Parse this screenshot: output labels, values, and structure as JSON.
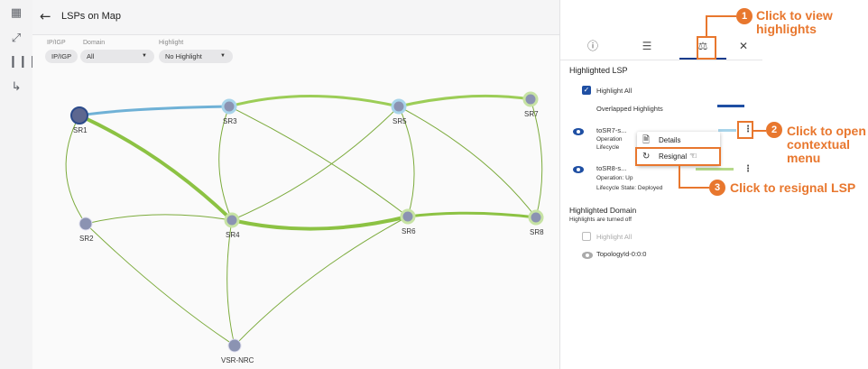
{
  "header": {
    "back_icon": "arrow-left-icon",
    "title": "LSPs on Map"
  },
  "sidebar": {
    "items": [
      "topology-icon",
      "link-icon",
      "barcode-icon",
      "path-icon"
    ]
  },
  "filters": {
    "ipigp": {
      "label": "IP/IGP",
      "value": "IP/IGP"
    },
    "domain": {
      "label": "Domain",
      "value": "All"
    },
    "highlight": {
      "label": "Highlight",
      "value": "No Highlight"
    }
  },
  "nodes": {
    "SR1": "SR1",
    "SR2": "SR2",
    "SR3": "SR3",
    "SR4": "SR4",
    "SR5": "SR5",
    "SR6": "SR6",
    "SR7": "SR7",
    "SR8": "SR8",
    "VSR": "VSR-NRC"
  },
  "panel": {
    "tabs": [
      "info-icon",
      "list-icon",
      "sliders-icon"
    ],
    "close_icon": "close-icon",
    "highlighted_lsp_title": "Highlighted LSP",
    "highlight_all": "Highlight All",
    "overlapped": "Overlapped Highlights",
    "lsp1": {
      "name": "toSR7-s...",
      "op": "Operation",
      "lc": "Lifecycle"
    },
    "lsp2": {
      "name": "toSR8-s...",
      "op": "Operation: Up",
      "lc": "Lifecycle State: Deployed"
    },
    "domain_title": "Highlighted Domain",
    "domain_sub": "Highlights are turned off",
    "domain_highlight_all": "Highlight All",
    "topology": "TopologyId-0:0:0"
  },
  "menu": {
    "details": "Details",
    "resignal": "Resignal"
  },
  "callouts": {
    "c1_num": "1",
    "c1_l1": "Click to view",
    "c1_l2": "highlights",
    "c2_num": "2",
    "c2_l1": "Click to open",
    "c2_l2": "contextual",
    "c2_l3": "menu",
    "c3_num": "3",
    "c3_text": "Click to resignal LSP"
  },
  "colors": {
    "accent": "#e8772e",
    "brand": "#1f4fa3"
  }
}
